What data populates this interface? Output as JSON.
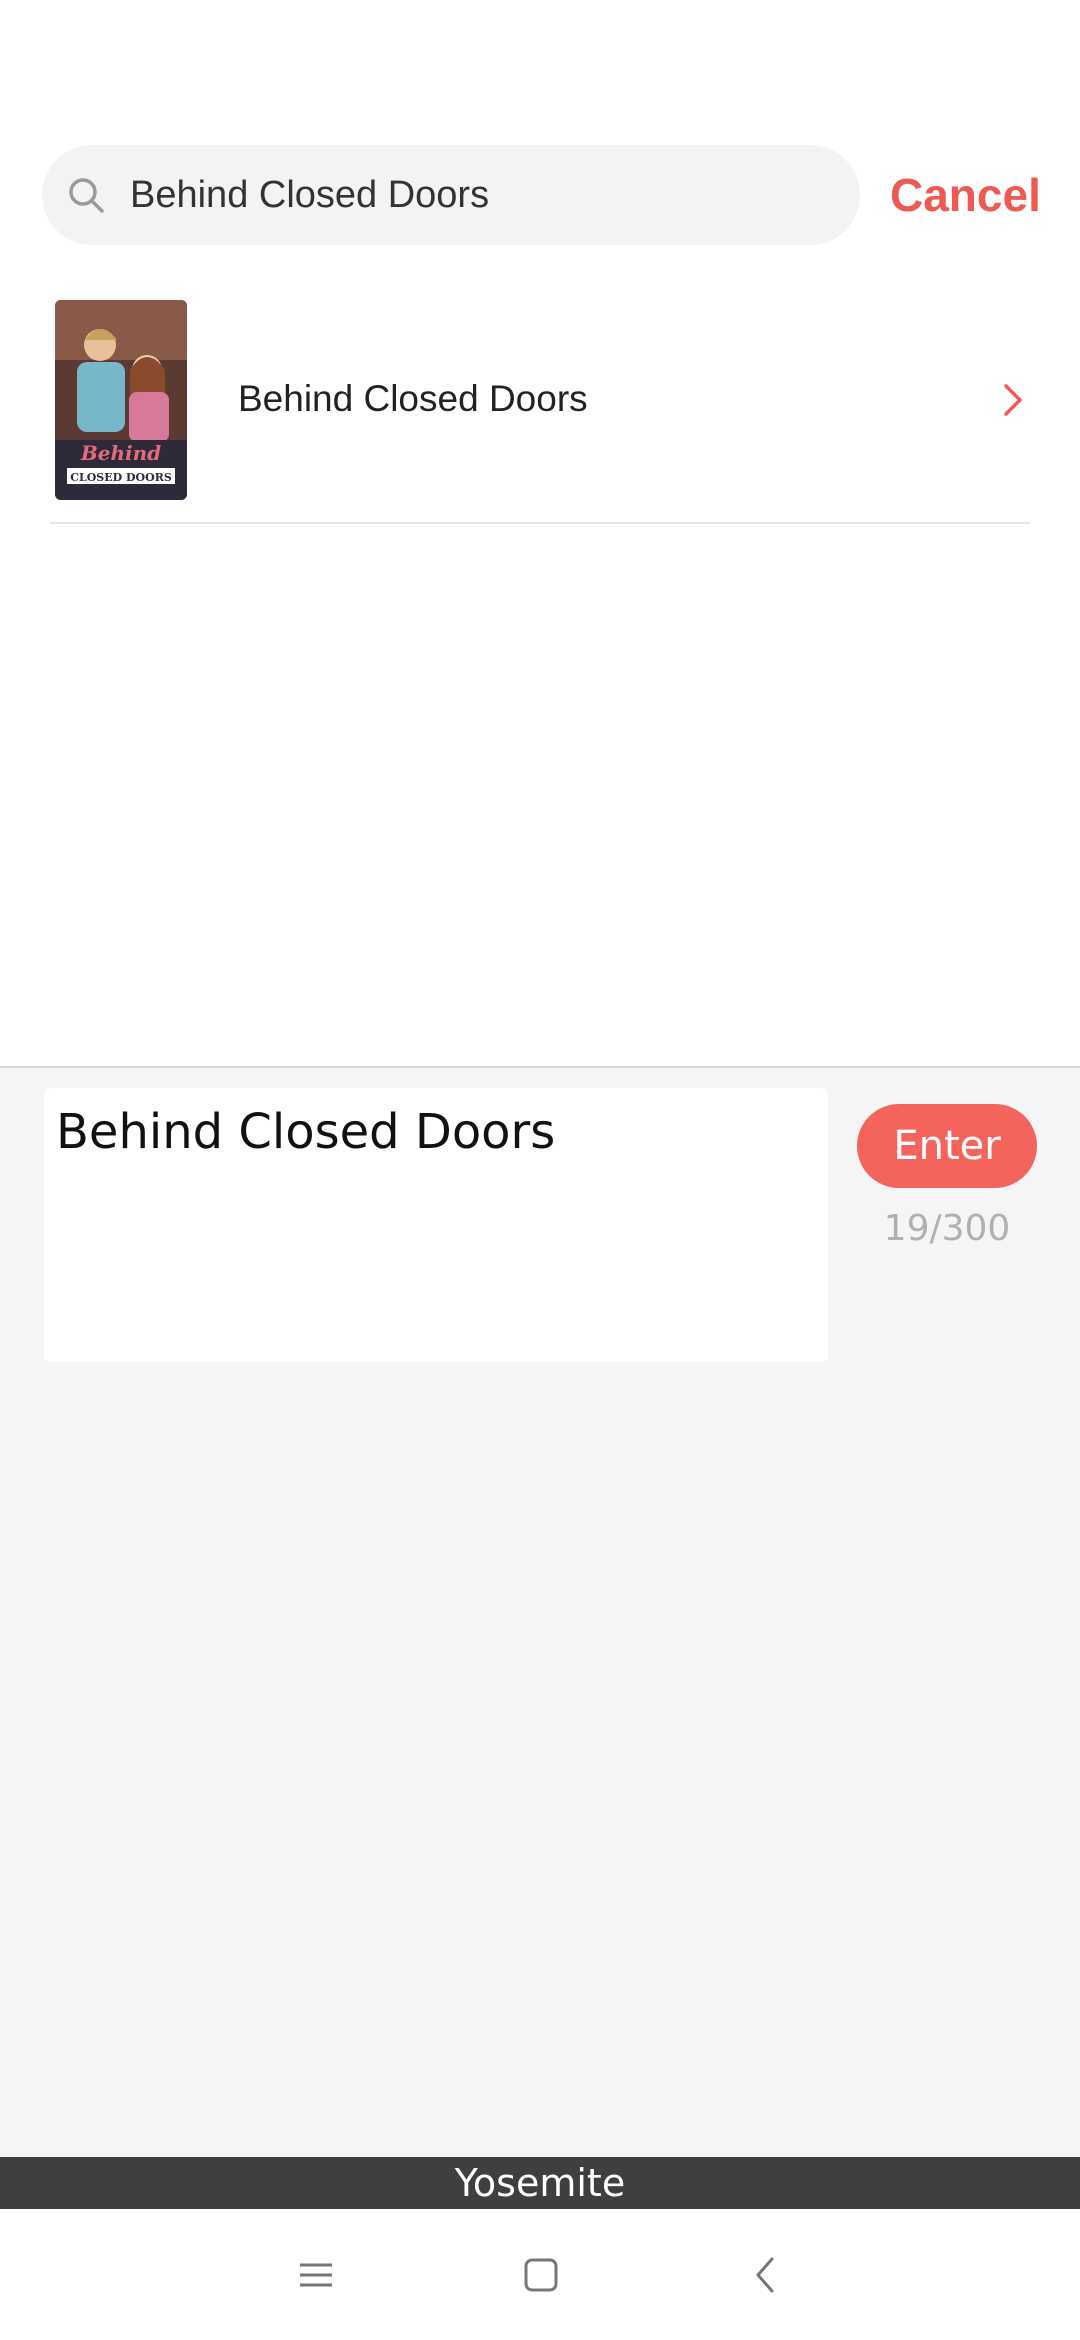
{
  "search": {
    "value": "Behind Closed Doors",
    "cancel_label": "Cancel"
  },
  "results": [
    {
      "title": "Behind Closed Doors",
      "thumb_caption": "CLOSED DOORS",
      "thumb_logo": "Behind"
    }
  ],
  "input_panel": {
    "text": "Behind Closed Doors",
    "enter_label": "Enter",
    "counter": "19/300"
  },
  "keyboard": {
    "name": "Yosemite"
  },
  "colors": {
    "accent": "#ee5a52",
    "enter_bg": "#f4645d",
    "panel_bg": "#f5f5f5",
    "search_bg": "#f2f3f5"
  },
  "icons": {
    "search": "search-icon",
    "chevron": "chevron-right-icon",
    "nav_menu": "menu-icon",
    "nav_home": "home-icon",
    "nav_back": "back-icon"
  }
}
